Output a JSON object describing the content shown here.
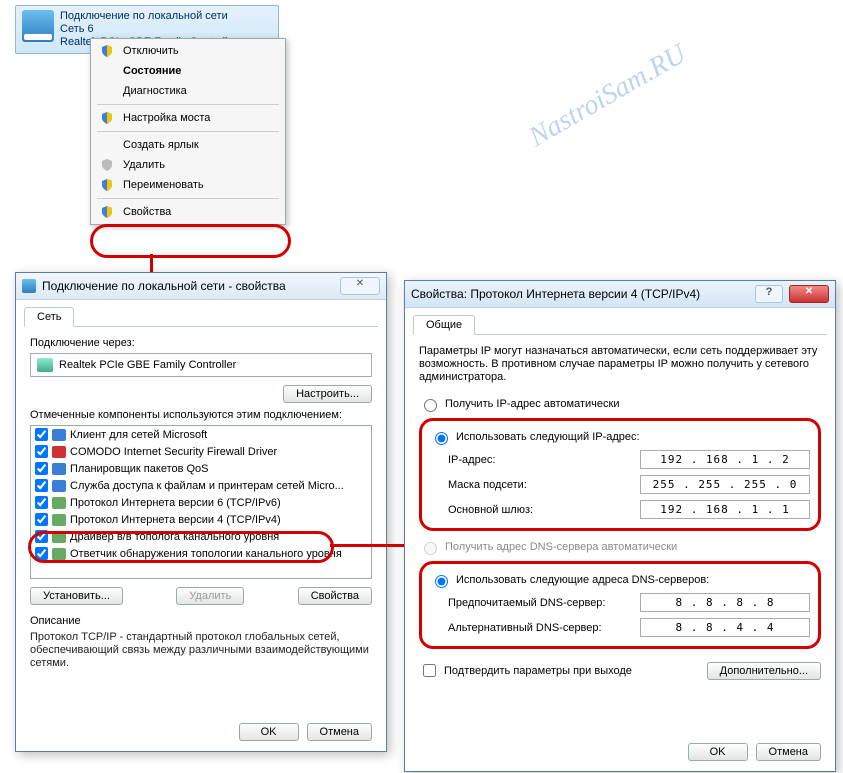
{
  "watermark": "NastroiSam.RU",
  "net_tile": {
    "title": "Подключение по локальной сети",
    "line2": "Сеть 6",
    "line3": "Realtek PCIe GBE Family Controller"
  },
  "ctx": {
    "disable": "Отключить",
    "state": "Состояние",
    "diag": "Диагностика",
    "bridge": "Настройка моста",
    "shortcut": "Создать ярлык",
    "delete": "Удалить",
    "rename": "Переименовать",
    "props": "Свойства"
  },
  "dlg1": {
    "title": "Подключение по локальной сети - свойства",
    "tab": "Сеть",
    "conn_through": "Подключение через:",
    "adapter": "Realtek PCIe GBE Family Controller",
    "configure": "Настроить...",
    "comps_label": "Отмеченные компоненты используются этим подключением:",
    "items": [
      "Клиент для сетей Microsoft",
      "COMODO Internet Security Firewall Driver",
      "Планировщик пакетов QoS",
      "Служба доступа к файлам и принтерам сетей Micro...",
      "Протокол Интернета версии 6 (TCP/IPv6)",
      "Протокол Интернета версии 4 (TCP/IPv4)",
      "Драйвер в/в тополога канального уровня",
      "Ответчик обнаружения топологии канального уровня"
    ],
    "install": "Установить...",
    "remove": "Удалить",
    "props": "Свойства",
    "desc_title": "Описание",
    "desc": "Протокол TCP/IP - стандартный протокол глобальных сетей, обеспечивающий связь между различными взаимодействующими сетями.",
    "ok": "OK",
    "cancel": "Отмена"
  },
  "dlg2": {
    "title": "Свойства: Протокол Интернета версии 4 (TCP/IPv4)",
    "tab": "Общие",
    "intro": "Параметры IP могут назначаться автоматически, если сеть поддерживает эту возможность. В противном случае параметры IP можно получить у сетевого администратора.",
    "auto_ip": "Получить IP-адрес автоматически",
    "use_ip": "Использовать следующий IP-адрес:",
    "ip_label": "IP-адрес:",
    "mask_label": "Маска подсети:",
    "gw_label": "Основной шлюз:",
    "ip": "192 . 168 .  1  .  2",
    "mask": "255 . 255 . 255 .  0",
    "gw": "192 . 168 .  1  .  1",
    "auto_dns": "Получить адрес DNS-сервера автоматически",
    "use_dns": "Использовать следующие адреса DNS-серверов:",
    "dns1_label": "Предпочитаемый DNS-сервер:",
    "dns2_label": "Альтернативный DNS-сервер:",
    "dns1": "8  .  8  .  8  .  8",
    "dns2": "8  .  8  .  4  .  4",
    "validate": "Подтвердить параметры при выходе",
    "advanced": "Дополнительно...",
    "ok": "OK",
    "cancel": "Отмена"
  }
}
